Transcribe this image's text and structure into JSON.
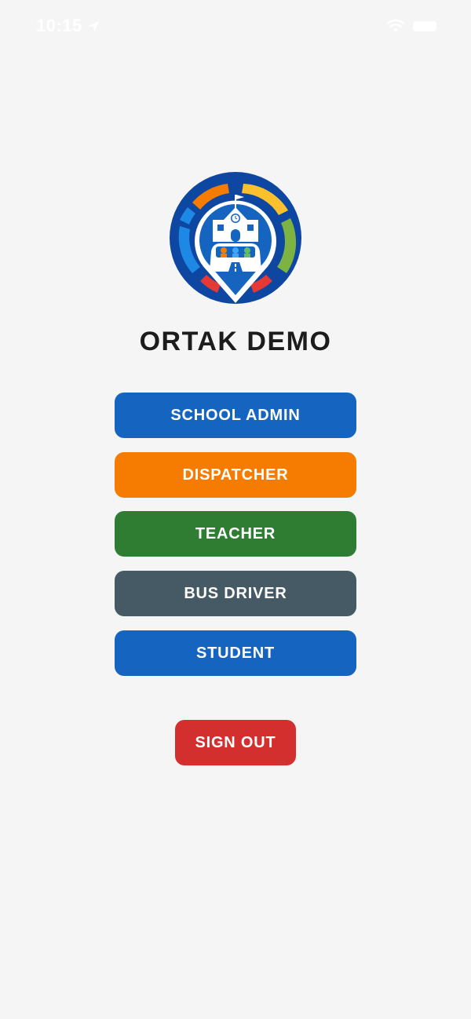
{
  "status_bar": {
    "time": "10:15"
  },
  "app": {
    "title": "ORTAK DEMO",
    "logo_icon": "school-bus-location-pin-logo"
  },
  "roles": [
    {
      "label": "SCHOOL ADMIN",
      "color": "#1565c0"
    },
    {
      "label": "DISPATCHER",
      "color": "#f57c00"
    },
    {
      "label": "TEACHER",
      "color": "#2e7d32"
    },
    {
      "label": "BUS DRIVER",
      "color": "#455a64"
    },
    {
      "label": "STUDENT",
      "color": "#1565c0"
    }
  ],
  "sign_out": {
    "label": "SIGN OUT",
    "color": "#d32f2f"
  },
  "colors": {
    "background": "#f5f5f5",
    "title_text": "#1c1c1c"
  }
}
